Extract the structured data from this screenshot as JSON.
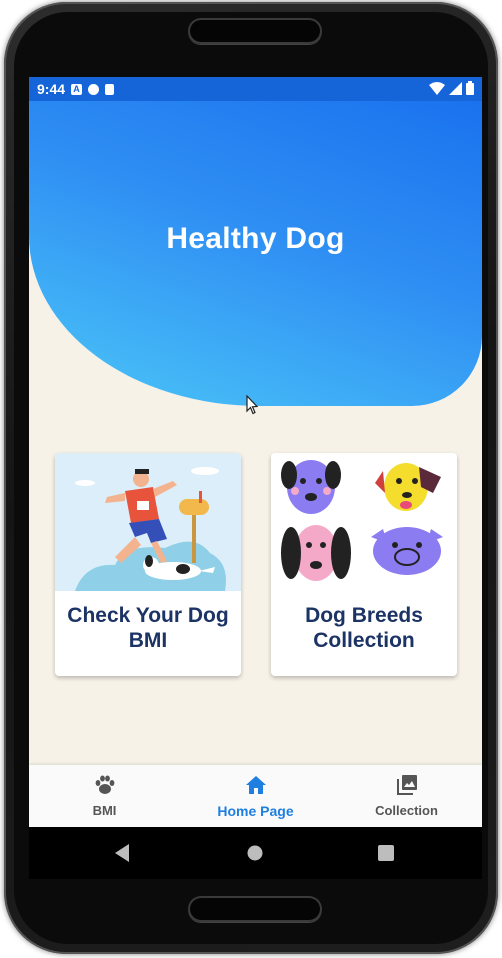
{
  "status_bar": {
    "time": "9:44"
  },
  "header": {
    "title": "Healthy Dog"
  },
  "cards": [
    {
      "label": "Check Your Dog BMI"
    },
    {
      "label": "Dog Breeds Collection"
    }
  ],
  "bottom_nav": {
    "items": [
      {
        "label": "BMI",
        "icon": "paw-icon",
        "active": false
      },
      {
        "label": "Home Page",
        "icon": "home-icon",
        "active": true
      },
      {
        "label": "Collection",
        "icon": "photo-library-icon",
        "active": false
      }
    ]
  },
  "colors": {
    "header_gradient_start": "#1a72ee",
    "header_gradient_end": "#4cc7f8",
    "background": "#f6f2e8",
    "card_text": "#1c3365",
    "active_nav": "#1e7fe0"
  }
}
